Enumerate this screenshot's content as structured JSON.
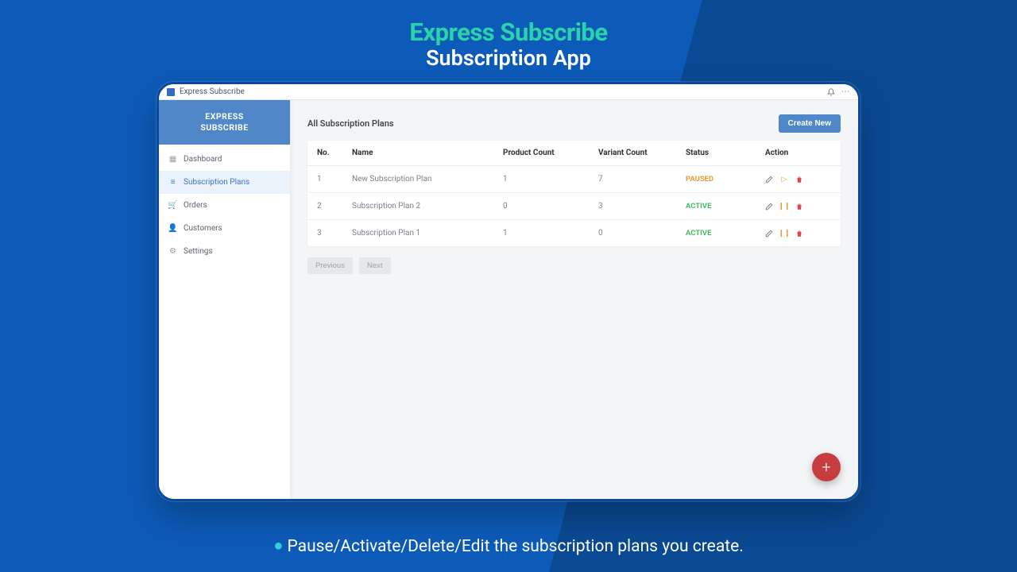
{
  "hero": {
    "title": "Express Subscribe",
    "subtitle": "Subscription App"
  },
  "titlebar": {
    "app_name": "Express Subscribe"
  },
  "brand": {
    "line1": "EXPRESS",
    "line2": "SUBSCRIBE"
  },
  "sidebar": {
    "items": [
      {
        "label": "Dashboard",
        "icon": "▦"
      },
      {
        "label": "Subscription Plans",
        "icon": "≡"
      },
      {
        "label": "Orders",
        "icon": "🛒"
      },
      {
        "label": "Customers",
        "icon": "👤"
      },
      {
        "label": "Settings",
        "icon": "⚙"
      }
    ]
  },
  "main": {
    "heading": "All Subscription Plans",
    "create_label": "Create New",
    "columns": {
      "no": "No.",
      "name": "Name",
      "product_count": "Product Count",
      "variant_count": "Variant Count",
      "status": "Status",
      "action": "Action"
    },
    "rows": [
      {
        "no": "1",
        "name": "New Subscription Plan",
        "product_count": "1",
        "variant_count": "7",
        "status": "PAUSED",
        "status_class": "status-paused",
        "toggle_icon": "▷",
        "toggle_name": "play-icon"
      },
      {
        "no": "2",
        "name": "Subscription Plan 2",
        "product_count": "0",
        "variant_count": "3",
        "status": "ACTIVE",
        "status_class": "status-active",
        "toggle_icon": "❙❙",
        "toggle_name": "pause-icon"
      },
      {
        "no": "3",
        "name": "Subscription Plan 1",
        "product_count": "1",
        "variant_count": "0",
        "status": "ACTIVE",
        "status_class": "status-active",
        "toggle_icon": "❙❙",
        "toggle_name": "pause-icon"
      }
    ],
    "pager": {
      "prev": "Previous",
      "next": "Next"
    }
  },
  "caption": "Pause/Activate/Delete/Edit the subscription plans you create."
}
